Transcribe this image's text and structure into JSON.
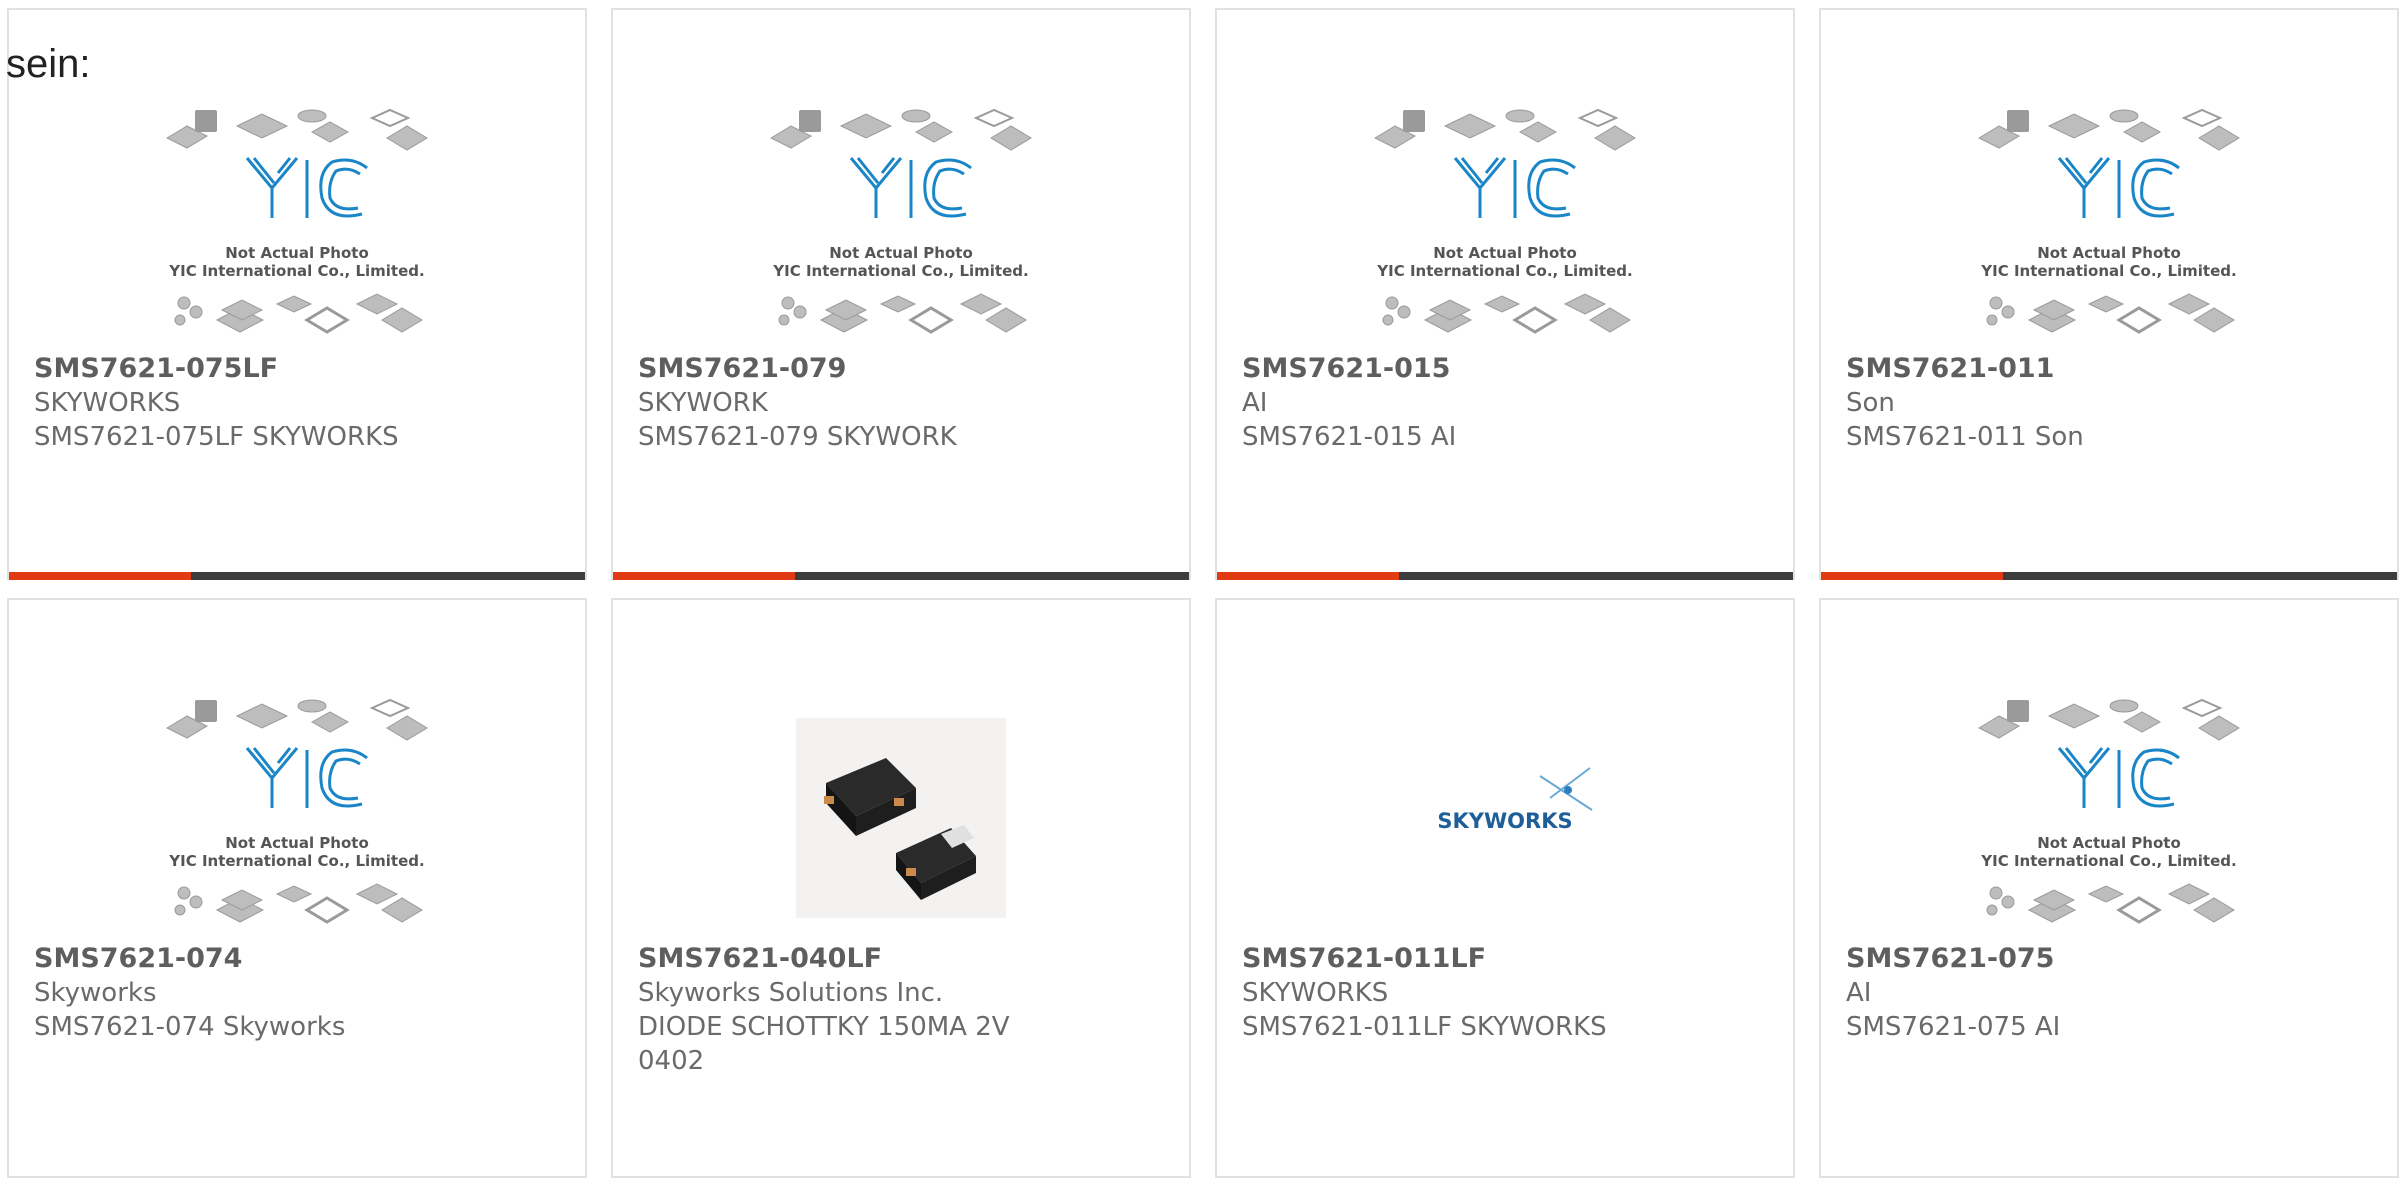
{
  "intro_text": "sein:",
  "placeholder": {
    "line1": "Not Actual Photo",
    "line2": "YIC International Co., Limited.",
    "logo": "YIC"
  },
  "skyworks_logo_text": "SKYWORKS",
  "colors": {
    "accent": "#e23a12",
    "bar": "#3d3d3d",
    "logo_blue": "#1a86c7"
  },
  "rows": [
    {
      "cards": [
        {
          "part": "SMS7621-075LF",
          "maker": "SKYWORKS",
          "desc": "SMS7621-075LF SKYWORKS",
          "image": "placeholder"
        },
        {
          "part": "SMS7621-079",
          "maker": "SKYWORK",
          "desc": "SMS7621-079 SKYWORK",
          "image": "placeholder"
        },
        {
          "part": "SMS7621-015",
          "maker": "AI",
          "desc": "SMS7621-015 AI",
          "image": "placeholder"
        },
        {
          "part": "SMS7621-011",
          "maker": "Son",
          "desc": "SMS7621-011 Son",
          "image": "placeholder"
        }
      ]
    },
    {
      "cards": [
        {
          "part": "SMS7621-074",
          "maker": "Skyworks",
          "desc": "SMS7621-074 Skyworks",
          "image": "placeholder"
        },
        {
          "part": "SMS7621-040LF",
          "maker": "Skyworks Solutions Inc.",
          "desc": "DIODE SCHOTTKY 150MA 2V 0402",
          "image": "chip-photo"
        },
        {
          "part": "SMS7621-011LF",
          "maker": "SKYWORKS",
          "desc": "SMS7621-011LF SKYWORKS",
          "image": "skyworks-logo"
        },
        {
          "part": "SMS7621-075",
          "maker": "AI",
          "desc": "SMS7621-075 AI",
          "image": "placeholder"
        }
      ]
    }
  ]
}
